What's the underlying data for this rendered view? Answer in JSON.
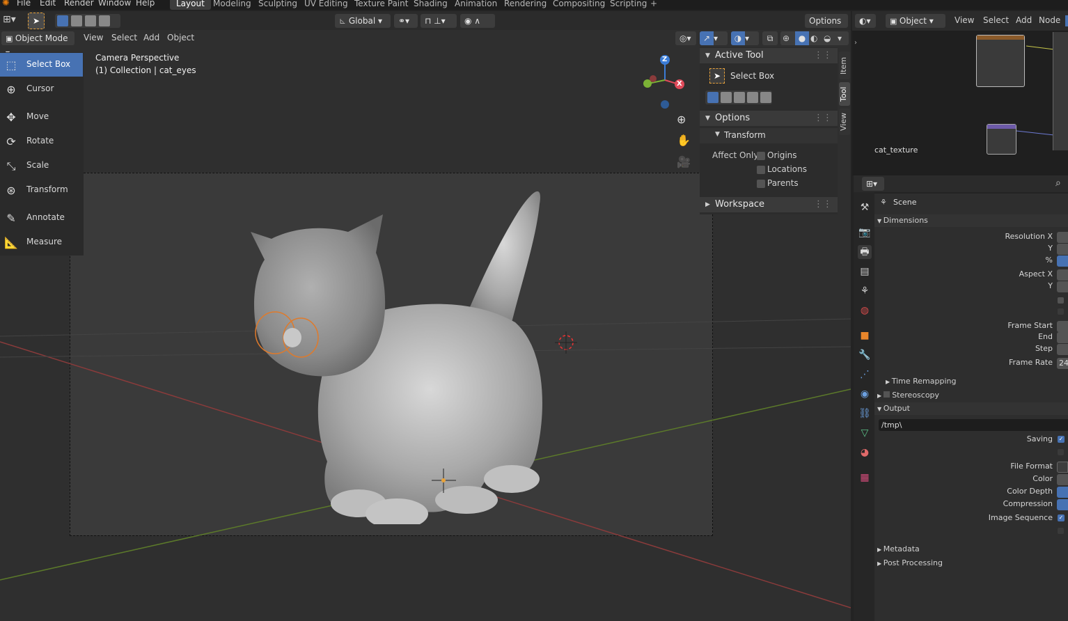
{
  "topmenu": {
    "items": [
      "File",
      "Edit",
      "Render",
      "Window",
      "Help"
    ]
  },
  "workspaces": [
    {
      "label": "Layout",
      "active": true
    },
    {
      "label": "Modeling"
    },
    {
      "label": "Sculpting"
    },
    {
      "label": "UV Editing"
    },
    {
      "label": "Texture Paint"
    },
    {
      "label": "Shading"
    },
    {
      "label": "Animation"
    },
    {
      "label": "Rendering"
    },
    {
      "label": "Compositing"
    },
    {
      "label": "Scripting"
    }
  ],
  "add_workspace": "+",
  "tool_header": {
    "orientation": "Global",
    "options": "Options"
  },
  "viewport_header": {
    "mode": "Object Mode",
    "menus": [
      "View",
      "Select",
      "Add",
      "Object"
    ]
  },
  "viewport": {
    "perspective": "Camera Perspective",
    "collection": "(1) Collection | cat_eyes"
  },
  "gizmo": {
    "z": "Z",
    "x": "X"
  },
  "tools": [
    {
      "label": "Select Box",
      "icon": "select-box-icon",
      "active": true
    },
    {
      "label": "Cursor",
      "icon": "cursor-icon"
    },
    {
      "label": "Move",
      "icon": "move-icon"
    },
    {
      "label": "Rotate",
      "icon": "rotate-icon"
    },
    {
      "label": "Scale",
      "icon": "scale-icon"
    },
    {
      "label": "Transform",
      "icon": "transform-icon"
    },
    {
      "label": "Annotate",
      "icon": "annotate-icon"
    },
    {
      "label": "Measure",
      "icon": "measure-icon"
    }
  ],
  "npanel": {
    "active_tool": "Active Tool",
    "select_box": "Select Box",
    "options": "Options",
    "transform": "Transform",
    "affect_only": "Affect Only",
    "origins": "Origins",
    "locations": "Locations",
    "parents": "Parents",
    "workspace": "Workspace",
    "tabs": [
      "Item",
      "Tool",
      "View"
    ]
  },
  "node_editor": {
    "type": "Object",
    "menus": [
      "View",
      "Select",
      "Add",
      "Node"
    ],
    "texture_label": "cat_texture"
  },
  "properties": {
    "scene": "Scene",
    "dimensions": "Dimensions",
    "resolution_x": "Resolution X",
    "y": "Y",
    "percent": "%",
    "aspect_x": "Aspect X",
    "frame_start": "Frame Start",
    "end": "End",
    "step": "Step",
    "frame_rate": "Frame Rate",
    "frame_rate_value": "24",
    "time_remapping": "Time Remapping",
    "stereoscopy": "Stereoscopy",
    "output": "Output",
    "output_path": "/tmp\\",
    "saving": "Saving",
    "file_format": "File Format",
    "color": "Color",
    "color_depth": "Color Depth",
    "compression": "Compression",
    "image_sequence": "Image Sequence",
    "metadata": "Metadata",
    "post_processing": "Post Processing"
  }
}
